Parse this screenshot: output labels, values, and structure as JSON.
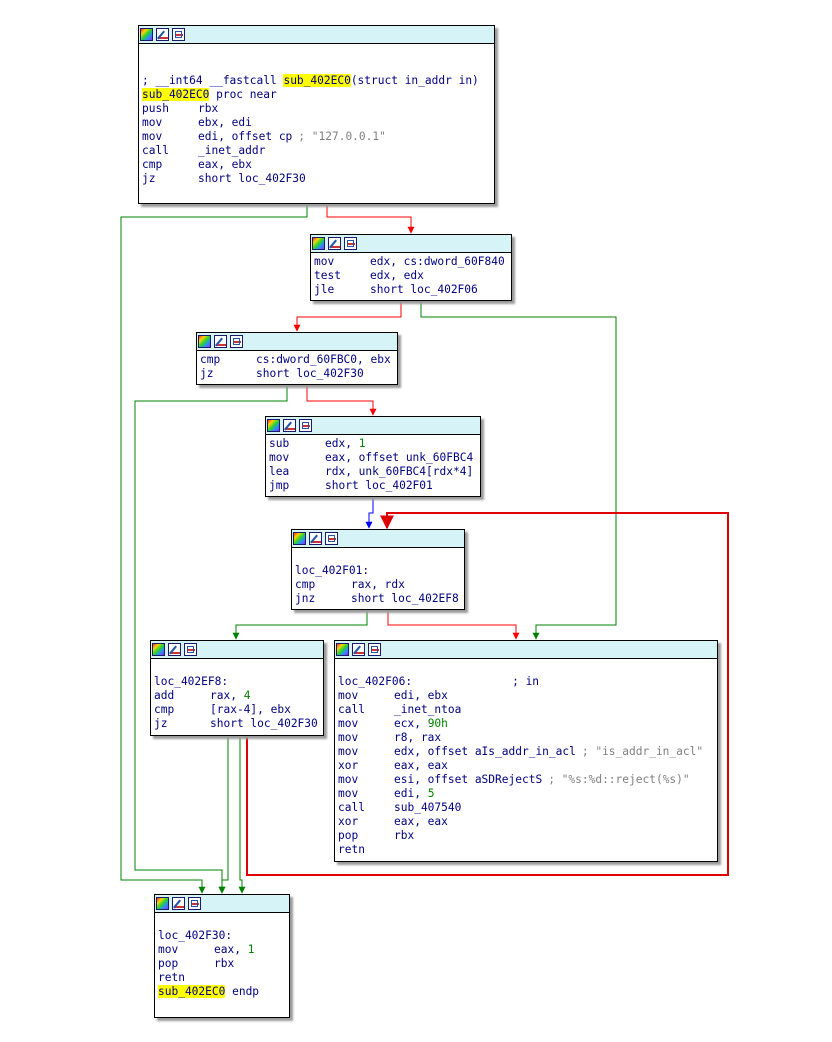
{
  "n1": {
    "blank_lines": 2,
    "comment_prefix": "; __int64 __fastcall ",
    "func": "sub_402EC0",
    "signature": "(struct in_addr in)",
    "proc_label": "sub_402EC0",
    "proc_rest": " proc near",
    "lines": [
      {
        "m": "push",
        "o": "rbx"
      },
      {
        "m": "mov",
        "o": "ebx, edi"
      },
      {
        "m": "mov",
        "o": "edi, offset cp",
        "c": "; \"127.0.0.1\""
      },
      {
        "m": "call",
        "o": "_inet_addr"
      },
      {
        "m": "cmp",
        "o": "eax, ebx"
      },
      {
        "m": "jz",
        "o": "short loc_402F30"
      }
    ]
  },
  "n2": {
    "lines": [
      {
        "m": "mov",
        "o": "edx, cs:dword_60F840"
      },
      {
        "m": "test",
        "o": "edx, edx"
      },
      {
        "m": "jle",
        "o": "short loc_402F06"
      }
    ]
  },
  "n3": {
    "lines": [
      {
        "m": "cmp",
        "o": "cs:dword_60FBC0, ebx"
      },
      {
        "m": "jz",
        "o": "short loc_402F30"
      }
    ]
  },
  "n4": {
    "lines": [
      {
        "m": "sub",
        "o": "edx, ",
        "n": "1"
      },
      {
        "m": "mov",
        "o": "eax, offset unk_60FBC4"
      },
      {
        "m": "lea",
        "o": "rdx, unk_60FBC4[rdx*4]"
      },
      {
        "m": "jmp",
        "o": "short loc_402F01"
      }
    ]
  },
  "n5": {
    "label": "loc_402F01:",
    "lines": [
      {
        "m": "cmp",
        "o": "rax, rdx"
      },
      {
        "m": "jnz",
        "o": "short loc_402EF8"
      }
    ]
  },
  "n6": {
    "label": "loc_402EF8:",
    "lines": [
      {
        "m": "add",
        "o": "rax, ",
        "n": "4"
      },
      {
        "m": "cmp",
        "o": "[rax-4], ebx"
      },
      {
        "m": "jz",
        "o": "short loc_402F30"
      }
    ]
  },
  "n7": {
    "label": "loc_402F06:",
    "label_comment": "; in",
    "lines": [
      {
        "m": "mov",
        "o": "edi, ebx"
      },
      {
        "m": "call",
        "o": "_inet_ntoa"
      },
      {
        "m": "mov",
        "o": "ecx, ",
        "n": "90h"
      },
      {
        "m": "mov",
        "o": "r8, rax"
      },
      {
        "m": "mov",
        "o": "edx, offset aIs_addr_in_acl",
        "c": "; \"is_addr_in_acl\""
      },
      {
        "m": "xor",
        "o": "eax, eax"
      },
      {
        "m": "mov",
        "o": "esi, offset aSDRejectS",
        "c": "; \"%s:%d::reject(%s)\""
      },
      {
        "m": "mov",
        "o": "edi, ",
        "n": "5"
      },
      {
        "m": "call",
        "o": "sub_407540"
      },
      {
        "m": "xor",
        "o": "eax, eax"
      },
      {
        "m": "pop",
        "o": "rbx"
      },
      {
        "m": "retn",
        "o": ""
      }
    ]
  },
  "n8": {
    "label": "loc_402F30:",
    "lines": [
      {
        "m": "mov",
        "o": "eax, ",
        "n": "1"
      },
      {
        "m": "pop",
        "o": "rbx"
      },
      {
        "m": "retn",
        "o": ""
      }
    ],
    "endp_label": "sub_402EC0",
    "endp_rest": " endp"
  },
  "colors": {
    "true_edge": "#008000",
    "false_edge": "#ff0000",
    "uncond_edge": "#0000ff",
    "back_edge": "#e00000"
  }
}
